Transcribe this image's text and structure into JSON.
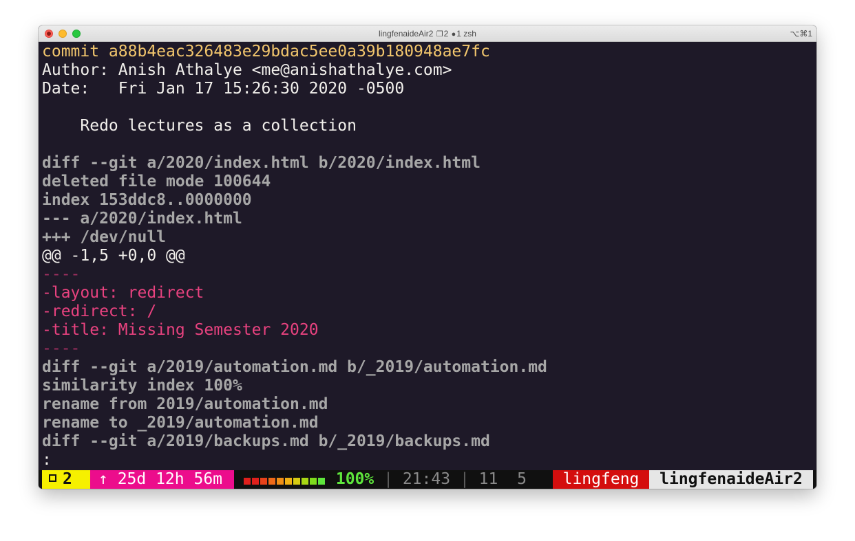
{
  "window": {
    "title_host": "lingfenaideAir2",
    "title_tab_count": "2",
    "title_process": "1 zsh",
    "shortcut": "⌥⌘1"
  },
  "terminal": {
    "lines": [
      {
        "text": "commit a88b4eac326483e29bdac5ee0a39b180948ae7fc",
        "color": "yellow"
      },
      {
        "text": "Author: Anish Athalye <me@anishathalye.com>",
        "color": "white"
      },
      {
        "text": "Date:   Fri Jan 17 15:26:30 2020 -0500",
        "color": "white"
      },
      {
        "text": "",
        "color": "white"
      },
      {
        "text": "    Redo lectures as a collection",
        "color": "white"
      },
      {
        "text": "",
        "color": "white"
      },
      {
        "text": "diff --git a/2020/index.html b/2020/index.html",
        "color": "gray"
      },
      {
        "text": "deleted file mode 100644",
        "color": "gray"
      },
      {
        "text": "index 153ddc8..0000000",
        "color": "gray"
      },
      {
        "text": "--- a/2020/index.html",
        "color": "gray"
      },
      {
        "text": "+++ /dev/null",
        "color": "gray"
      },
      {
        "text": "@@ -1,5 +0,0 @@",
        "color": "white"
      },
      {
        "text": "----",
        "color": "pink-dim"
      },
      {
        "text": "-layout: redirect",
        "color": "pink"
      },
      {
        "text": "-redirect: /",
        "color": "pink"
      },
      {
        "text": "-title: Missing Semester 2020",
        "color": "pink"
      },
      {
        "text": "----",
        "color": "pink-dim"
      },
      {
        "text": "diff --git a/2019/automation.md b/_2019/automation.md",
        "color": "gray"
      },
      {
        "text": "similarity index 100%",
        "color": "gray"
      },
      {
        "text": "rename from 2019/automation.md",
        "color": "gray"
      },
      {
        "text": "rename to _2019/automation.md",
        "color": "gray"
      },
      {
        "text": "diff --git a/2019/backups.md b/_2019/backups.md",
        "color": "gray"
      },
      {
        "text": ":",
        "color": "white"
      }
    ]
  },
  "statusbar": {
    "window_index": "2",
    "uptime": "↑ 25d 12h 56m",
    "battery": {
      "level_fraction": 1.0,
      "bar_colors": [
        "#e0201c",
        "#e0201c",
        "#e8421a",
        "#ef6a18",
        "#f08f16",
        "#f0b214",
        "#d6cc12",
        "#a8d814",
        "#7edc1c",
        "#5ee63c"
      ],
      "percent": "100%"
    },
    "divider": "|",
    "time": "21:43",
    "day": "11",
    "month": "5",
    "user": "lingfeng",
    "host": "lingfenaideAir2"
  }
}
